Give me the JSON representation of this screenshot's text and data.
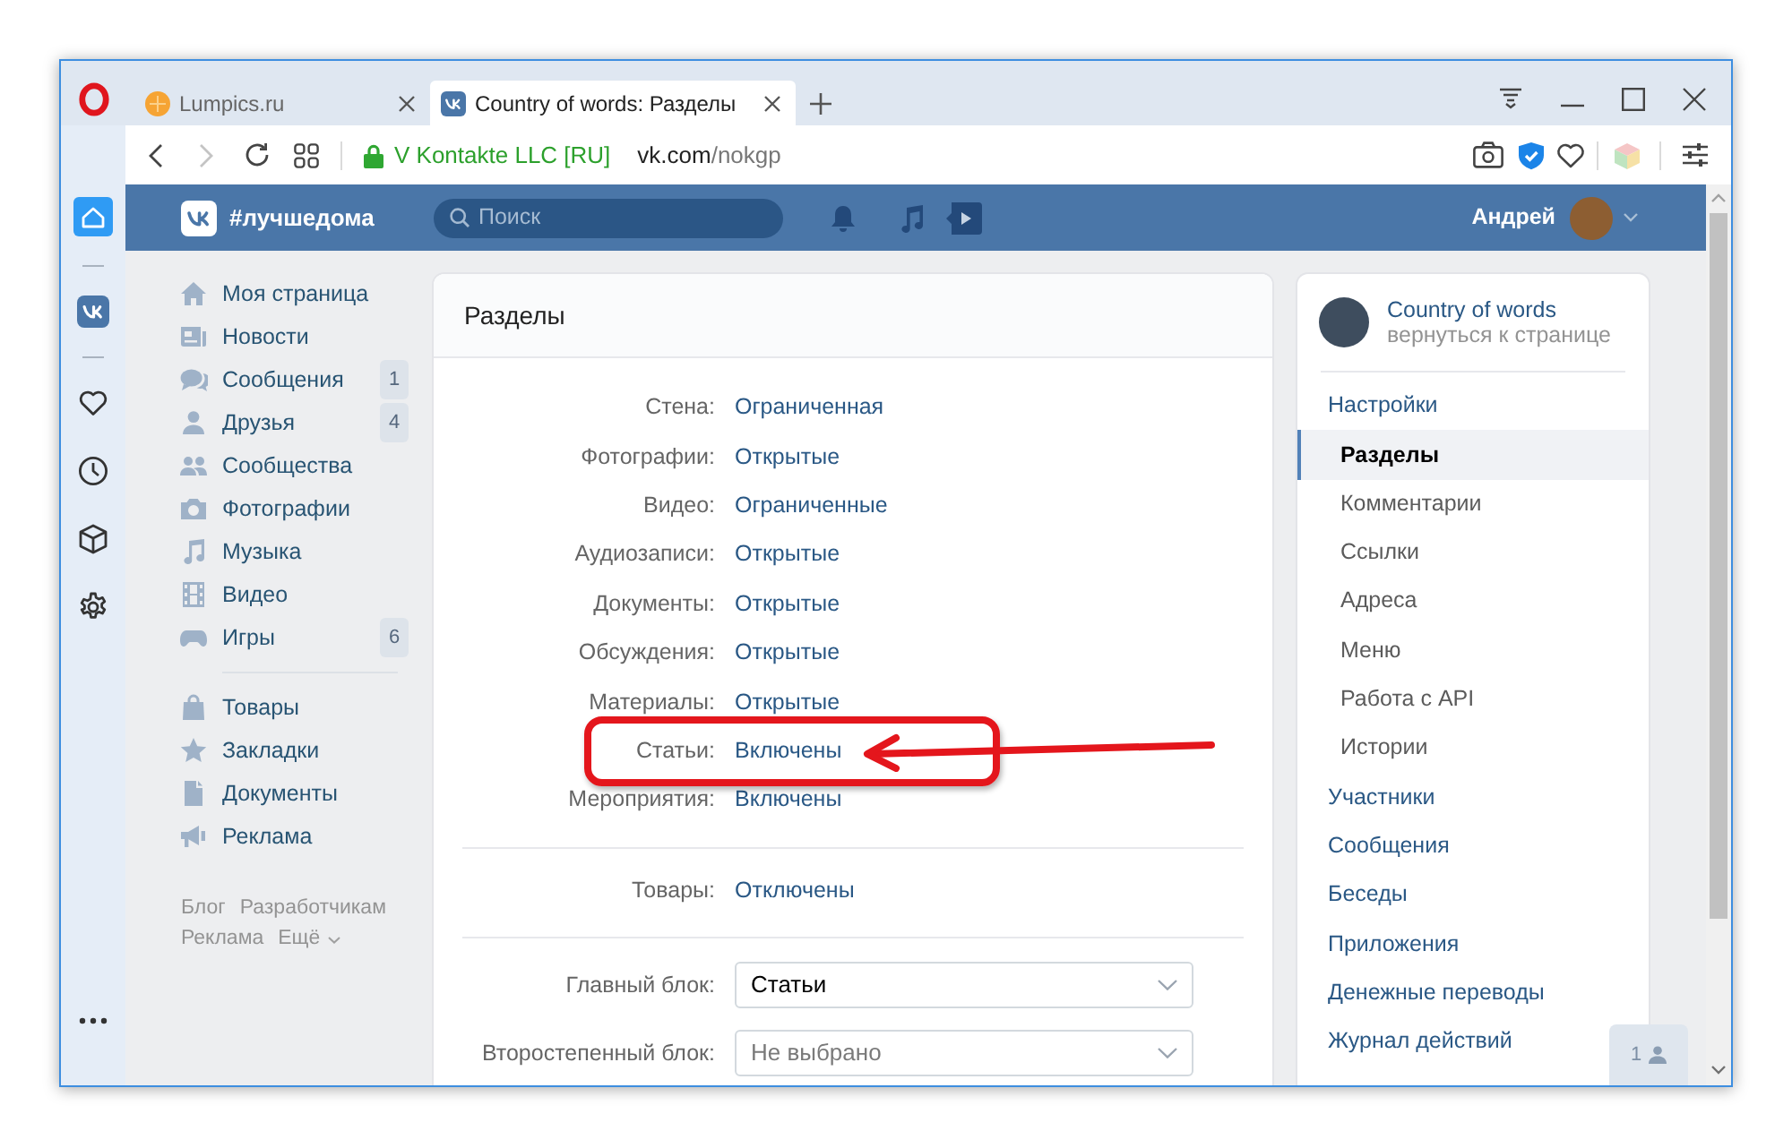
{
  "browser": {
    "tabs": [
      {
        "kind": "site",
        "title": "Lumpics.ru",
        "selected": false
      },
      {
        "kind": "vk",
        "title": "Country of words: Разделы",
        "selected": true
      }
    ],
    "navigation": {
      "back_disabled": false,
      "forward_disabled": true
    },
    "address": {
      "identity": "V Kontakte LLC [RU]",
      "host": "vk.com",
      "path": "/nokgp"
    }
  },
  "opera_sidebar": {
    "groups": [
      {
        "items": [
          {
            "kind": "home",
            "selected": true
          }
        ]
      },
      {
        "items": [
          {
            "kind": "messenger",
            "selected": false
          }
        ]
      },
      {
        "items": [
          {
            "kind": "favorites",
            "selected": false
          },
          {
            "kind": "history",
            "selected": false
          },
          {
            "kind": "extensions",
            "selected": false
          },
          {
            "kind": "settings",
            "selected": false
          }
        ]
      }
    ]
  },
  "vk_header": {
    "brand": "#лучшедома",
    "search": {
      "placeholder": "Поиск"
    },
    "user": {
      "name": "Андрей"
    }
  },
  "left_menu": {
    "sections": [
      {
        "items": [
          {
            "kind": "profile",
            "label": "Моя страница"
          },
          {
            "kind": "news",
            "label": "Новости"
          },
          {
            "kind": "messages",
            "label": "Сообщения",
            "badge": "1"
          },
          {
            "kind": "friends",
            "label": "Друзья",
            "badge": "4"
          },
          {
            "kind": "communities",
            "label": "Сообщества"
          },
          {
            "kind": "photos",
            "label": "Фотографии"
          },
          {
            "kind": "music",
            "label": "Музыка"
          },
          {
            "kind": "video",
            "label": "Видео"
          },
          {
            "kind": "games",
            "label": "Игры",
            "badge": "6"
          }
        ]
      },
      {
        "items": [
          {
            "kind": "market",
            "label": "Товары"
          },
          {
            "kind": "bookmarks",
            "label": "Закладки"
          },
          {
            "kind": "documents",
            "label": "Документы"
          },
          {
            "kind": "ads",
            "label": "Реклама"
          }
        ]
      }
    ],
    "footer_links": [
      "Блог",
      "Разработчикам",
      "Реклама"
    ],
    "more_link": "Ещё"
  },
  "sections_card": {
    "title": "Разделы",
    "groups": [
      {
        "rows": [
          {
            "label": "Стена:",
            "value": "Ограниченная"
          },
          {
            "label": "Фотографии:",
            "value": "Открытые"
          },
          {
            "label": "Видео:",
            "value": "Ограниченные"
          },
          {
            "label": "Аудиозаписи:",
            "value": "Открытые"
          },
          {
            "label": "Документы:",
            "value": "Открытые"
          },
          {
            "label": "Обсуждения:",
            "value": "Открытые"
          },
          {
            "label": "Материалы:",
            "value": "Открытые"
          },
          {
            "label": "Статьи:",
            "value": "Включены"
          },
          {
            "label": "Мероприятия:",
            "value": "Включены"
          }
        ]
      },
      {
        "rows": [
          {
            "label": "Товары:",
            "value": "Отключены"
          }
        ]
      }
    ],
    "selects": [
      {
        "label": "Главный блок:",
        "value": "Статьи"
      },
      {
        "label": "Второстепенный блок:",
        "placeholder": "Не выбрано"
      }
    ]
  },
  "community_menu": {
    "name": "Country of words",
    "back_link": "вернуться к странице",
    "items": [
      {
        "label": "Настройки",
        "selected": false,
        "children": [
          {
            "label": "Разделы",
            "selected": true
          },
          {
            "label": "Комментарии",
            "selected": false
          },
          {
            "label": "Ссылки",
            "selected": false
          },
          {
            "label": "Адреса",
            "selected": false
          },
          {
            "label": "Меню",
            "selected": false
          },
          {
            "label": "Работа с API",
            "selected": false
          },
          {
            "label": "Истории",
            "selected": false
          }
        ]
      },
      {
        "label": "Участники",
        "selected": false
      },
      {
        "label": "Сообщения",
        "selected": false
      },
      {
        "label": "Беседы",
        "selected": false
      },
      {
        "label": "Приложения",
        "selected": false
      },
      {
        "label": "Денежные переводы",
        "selected": false
      },
      {
        "label": "Журнал действий",
        "selected": false
      }
    ]
  },
  "chat_widget": {
    "count": "1"
  }
}
